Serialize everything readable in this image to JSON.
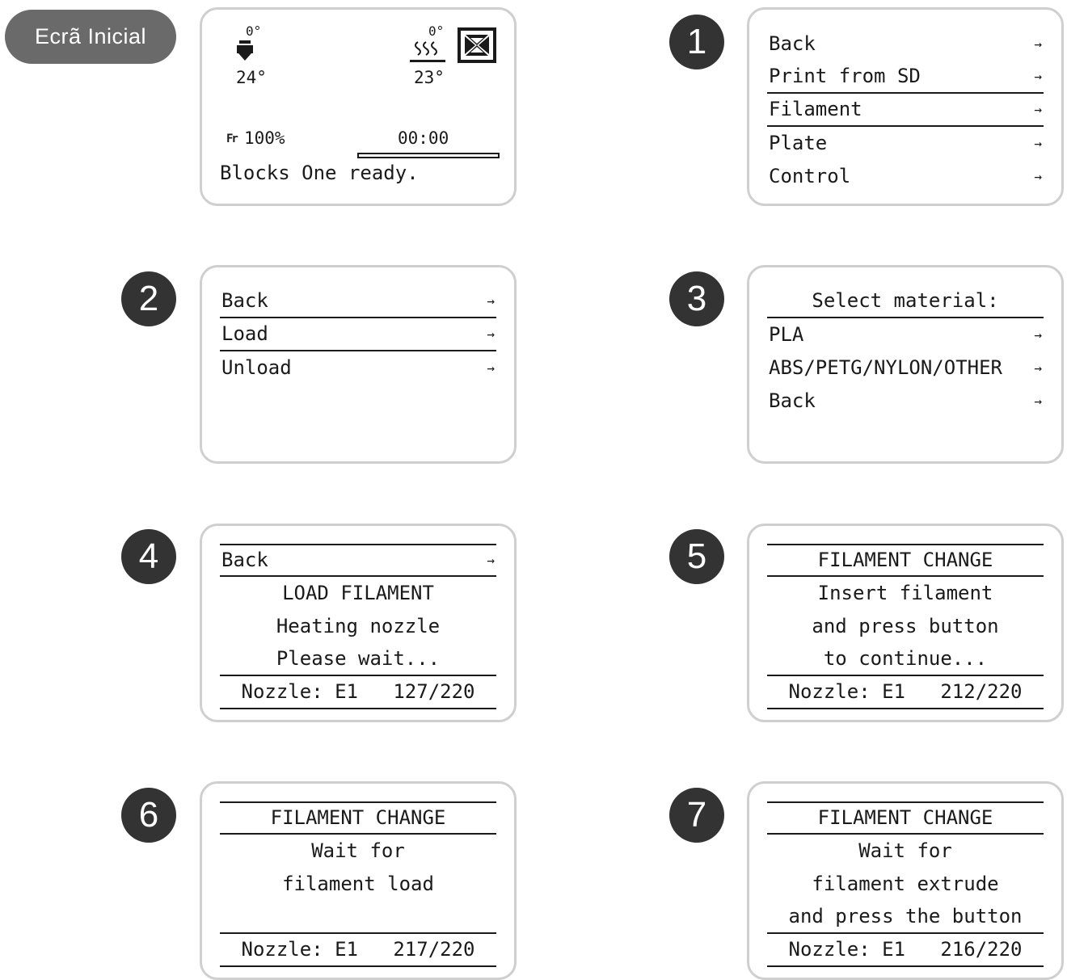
{
  "home_label": "Ecrã Inicial",
  "home": {
    "nozzle_target": "0°",
    "nozzle_current": "24°",
    "bed_target": "0°",
    "bed_current": "23°",
    "feedrate_icon": "Fr",
    "feedrate": "100%",
    "time": "00:00",
    "status": "Blocks One ready."
  },
  "steps": {
    "s1": {
      "number": "1",
      "items": [
        {
          "label": "Back",
          "arrow": "→"
        },
        {
          "label": "Print from SD",
          "arrow": "→"
        },
        {
          "label": "Filament",
          "arrow": "→"
        },
        {
          "label": "Plate",
          "arrow": "→"
        },
        {
          "label": "Control",
          "arrow": "→"
        }
      ]
    },
    "s2": {
      "number": "2",
      "items": [
        {
          "label": "Back",
          "arrow": "→"
        },
        {
          "label": "Load",
          "arrow": "→"
        },
        {
          "label": "Unload",
          "arrow": "→"
        }
      ]
    },
    "s3": {
      "number": "3",
      "title": "Select material:",
      "items": [
        {
          "label": "PLA",
          "arrow": "→"
        },
        {
          "label": "ABS/PETG/NYLON/OTHER",
          "arrow": "→"
        },
        {
          "label": "Back",
          "arrow": "→"
        }
      ]
    },
    "s4": {
      "number": "4",
      "back": "Back",
      "arrow": "→",
      "lines": [
        "LOAD FILAMENT",
        "Heating nozzle",
        "Please wait..."
      ],
      "nozzle": "Nozzle: E1   127/220"
    },
    "s5": {
      "number": "5",
      "title": "FILAMENT CHANGE",
      "lines": [
        "Insert filament",
        "and press button",
        "to continue..."
      ],
      "nozzle": "Nozzle: E1   212/220"
    },
    "s6": {
      "number": "6",
      "title": "FILAMENT CHANGE",
      "lines": [
        "Wait for",
        "filament load",
        ""
      ],
      "nozzle": "Nozzle: E1   217/220"
    },
    "s7": {
      "number": "7",
      "title": "FILAMENT CHANGE",
      "lines": [
        "Wait for",
        "filament extrude",
        "and press the button"
      ],
      "nozzle": "Nozzle: E1   216/220"
    }
  },
  "icons": [
    "nozzle-icon",
    "heated-bed-icon",
    "fan-icon",
    "feedrate-icon",
    "right-arrow-icon"
  ]
}
